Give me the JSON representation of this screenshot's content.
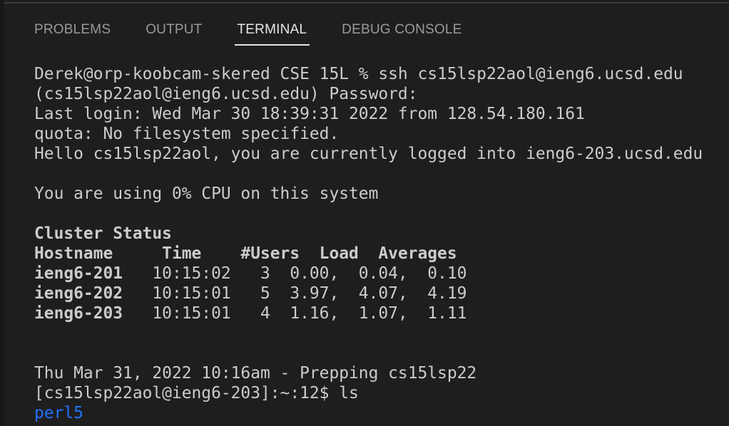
{
  "panel": {
    "tabs": [
      {
        "label": "PROBLEMS",
        "active": false
      },
      {
        "label": "OUTPUT",
        "active": false
      },
      {
        "label": "TERMINAL",
        "active": true
      },
      {
        "label": "DEBUG CONSOLE",
        "active": false
      }
    ]
  },
  "terminal": {
    "prompt_line": "Derek@orp-koobcam-skered CSE 15L % ssh cs15lsp22aol@ieng6.ucsd.edu",
    "password_line": "(cs15lsp22aol@ieng6.ucsd.edu) Password:",
    "last_login": "Last login: Wed Mar 30 18:39:31 2022 from 128.54.180.161",
    "quota": "quota: No filesystem specified.",
    "hello": "Hello cs15lsp22aol, you are currently logged into ieng6-203.ucsd.edu",
    "cpu": "You are using 0% CPU on this system",
    "cluster_title": "Cluster Status",
    "cluster_header": "Hostname     Time    #Users  Load  Averages",
    "cluster_rows": [
      {
        "host": "ieng6-201",
        "rest": "   10:15:02   3  0.00,  0.04,  0.10"
      },
      {
        "host": "ieng6-202",
        "rest": "   10:15:01   5  3.97,  4.07,  4.19"
      },
      {
        "host": "ieng6-203",
        "rest": "   10:15:01   4  1.16,  1.07,  1.11"
      }
    ],
    "date_line": "Thu Mar 31, 2022 10:16am - Prepping cs15lsp22",
    "ls_prompt": "[cs15lsp22aol@ieng6-203]:~:12$ ls",
    "ls_output": "perl5",
    "directory_color": "#2472ff"
  }
}
